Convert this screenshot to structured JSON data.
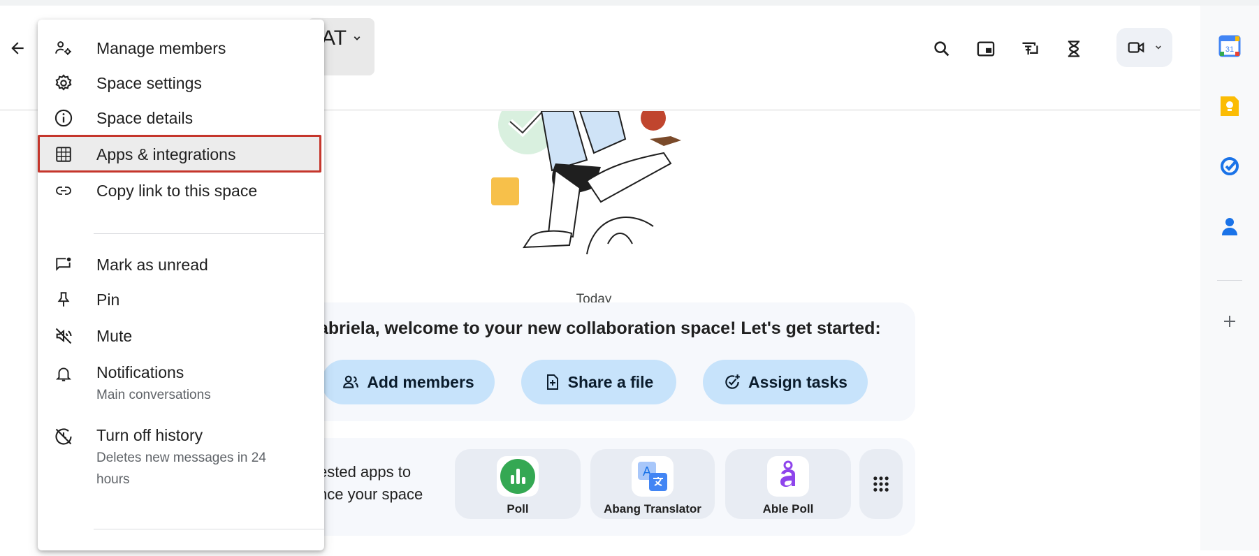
{
  "header": {
    "title": "AT",
    "back_label": "Back",
    "icons": [
      "search-icon",
      "picture-in-picture-icon",
      "pin-to-screen-icon",
      "hourglass-icon"
    ],
    "meet_icon": "video-camera-icon"
  },
  "menu": {
    "items": [
      {
        "label": "Manage members",
        "icon": "manage-members-icon"
      },
      {
        "label": "Space settings",
        "icon": "gear-icon"
      },
      {
        "label": "Space details",
        "icon": "info-icon"
      },
      {
        "label": "Apps & integrations",
        "icon": "apps-grid-icon",
        "highlighted": true
      },
      {
        "label": "Copy link to this space",
        "icon": "link-icon"
      },
      {
        "label": "Mark as unread",
        "icon": "mark-unread-icon"
      },
      {
        "label": "Pin",
        "icon": "pin-icon"
      },
      {
        "label": "Mute",
        "icon": "mute-icon"
      },
      {
        "label": "Notifications",
        "sub": "Main conversations",
        "icon": "bell-icon"
      },
      {
        "label": "Turn off history",
        "sub": "Deletes new messages in 24 hours",
        "icon": "history-off-icon"
      }
    ]
  },
  "main": {
    "date_divider": "Today",
    "welcome": "abriela, welcome to your new collaboration space! Let's get started:",
    "actions": [
      {
        "label": "Add members",
        "icon": "add-members-icon"
      },
      {
        "label": "Share a file",
        "icon": "share-file-icon"
      },
      {
        "label": "Assign tasks",
        "icon": "assign-tasks-icon"
      }
    ],
    "apps_text_line1": "ested apps to",
    "apps_text_line2": "nce your space",
    "apps": [
      {
        "name": "Poll",
        "color": "#34a853"
      },
      {
        "name": "Abang Translator",
        "color": "#4285f4"
      },
      {
        "name": "Able Poll",
        "color": "#8e44ec"
      }
    ]
  },
  "rail": {
    "icons": [
      "calendar-icon",
      "keep-icon",
      "tasks-icon",
      "contacts-icon",
      "add-icon"
    ],
    "calendar_day": "31"
  },
  "colors": {
    "highlight_border": "#c5362c",
    "action_button_bg": "#c7e3fb"
  }
}
